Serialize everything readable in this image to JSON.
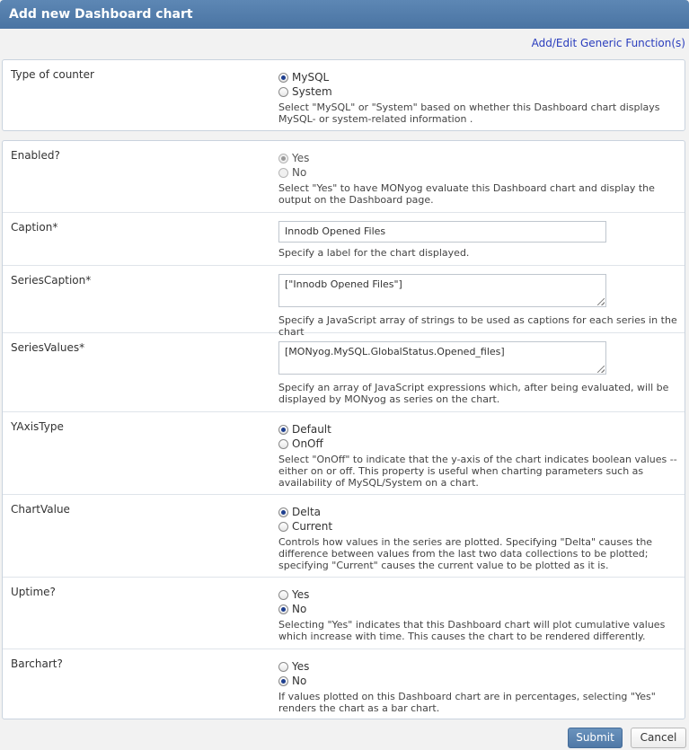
{
  "dialog": {
    "title": "Add new Dashboard chart",
    "generic_link": "Add/Edit Generic Function(s)"
  },
  "type_counter": {
    "label": "Type of counter",
    "options": [
      "MySQL",
      "System"
    ],
    "selected": "MySQL",
    "help": "Select \"MySQL\" or \"System\" based on whether this Dashboard chart displays MySQL- or system-related information ."
  },
  "enabled": {
    "label": "Enabled?",
    "options": [
      "Yes",
      "No"
    ],
    "selected": "Yes",
    "help": "Select \"Yes\" to have MONyog evaluate this Dashboard chart and display the output on the Dashboard page."
  },
  "caption": {
    "label": "Caption*",
    "value": "Innodb Opened Files",
    "help": "Specify a label for the chart displayed."
  },
  "series_caption": {
    "label": "SeriesCaption*",
    "value": "[\"Innodb Opened Files\"]",
    "help": "Specify a JavaScript array of strings to be used as captions for each series in the chart"
  },
  "series_values": {
    "label": "SeriesValues*",
    "value": "[MONyog.MySQL.GlobalStatus.Opened_files]",
    "help": "Specify an array of JavaScript expressions which, after being evaluated, will be displayed by MONyog as series on the chart."
  },
  "yaxis_type": {
    "label": "YAxisType",
    "options": [
      "Default",
      "OnOff"
    ],
    "selected": "Default",
    "help": "Select \"OnOff\" to indicate that the y-axis of the chart indicates boolean values -- either on or off. This property is useful when charting parameters such as availability of MySQL/System on a chart."
  },
  "chart_value": {
    "label": "ChartValue",
    "options": [
      "Delta",
      "Current"
    ],
    "selected": "Delta",
    "help": "Controls how values in the series are plotted. Specifying \"Delta\" causes the difference between values from the last two data collections to be plotted; specifying \"Current\" causes the current value to be plotted as it is."
  },
  "uptime": {
    "label": "Uptime?",
    "options": [
      "Yes",
      "No"
    ],
    "selected": "No",
    "help": "Selecting \"Yes\" indicates that this Dashboard chart will plot cumulative values which increase with time. This causes the chart to be rendered differently."
  },
  "barchart": {
    "label": "Barchart?",
    "options": [
      "Yes",
      "No"
    ],
    "selected": "No",
    "help": "If values plotted on this Dashboard chart are in percentages, selecting \"Yes\" renders the chart as a bar chart."
  },
  "buttons": {
    "submit": "Submit",
    "cancel": "Cancel"
  }
}
